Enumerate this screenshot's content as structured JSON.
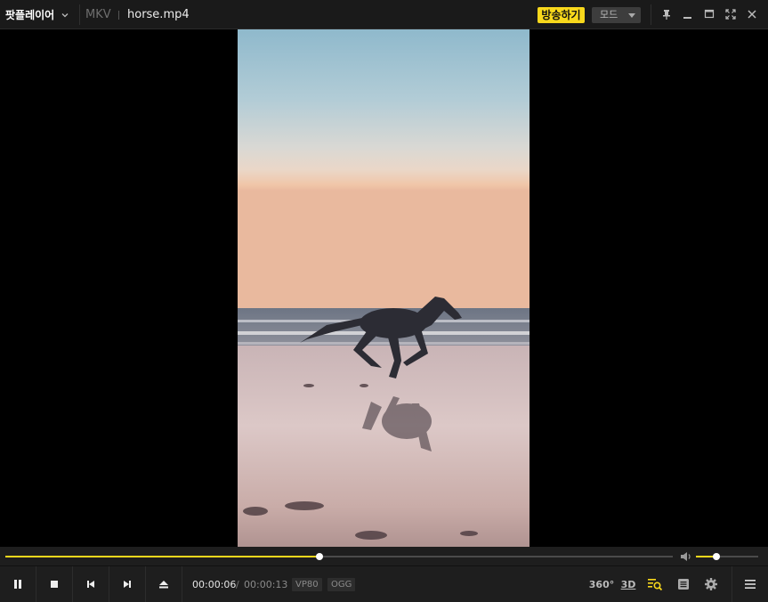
{
  "titlebar": {
    "app_name": "팟플레이어",
    "format": "MKV",
    "file_name": "horse.mp4",
    "broadcast_label": "방송하기",
    "mode_label": "모드"
  },
  "video": {
    "subject": "horse galloping on beach at sunset"
  },
  "playback": {
    "progress_fraction": 0.47,
    "volume_fraction": 0.33,
    "current_time": "00:00:06",
    "time_separator": "/",
    "total_time": "00:00:13",
    "video_codec": "VP80",
    "audio_codec": "OGG"
  },
  "controls": {
    "icon_360": "360°",
    "label_3d": "3D"
  },
  "colors": {
    "accent": "#f8d81c",
    "background": "#1e1e1e"
  }
}
